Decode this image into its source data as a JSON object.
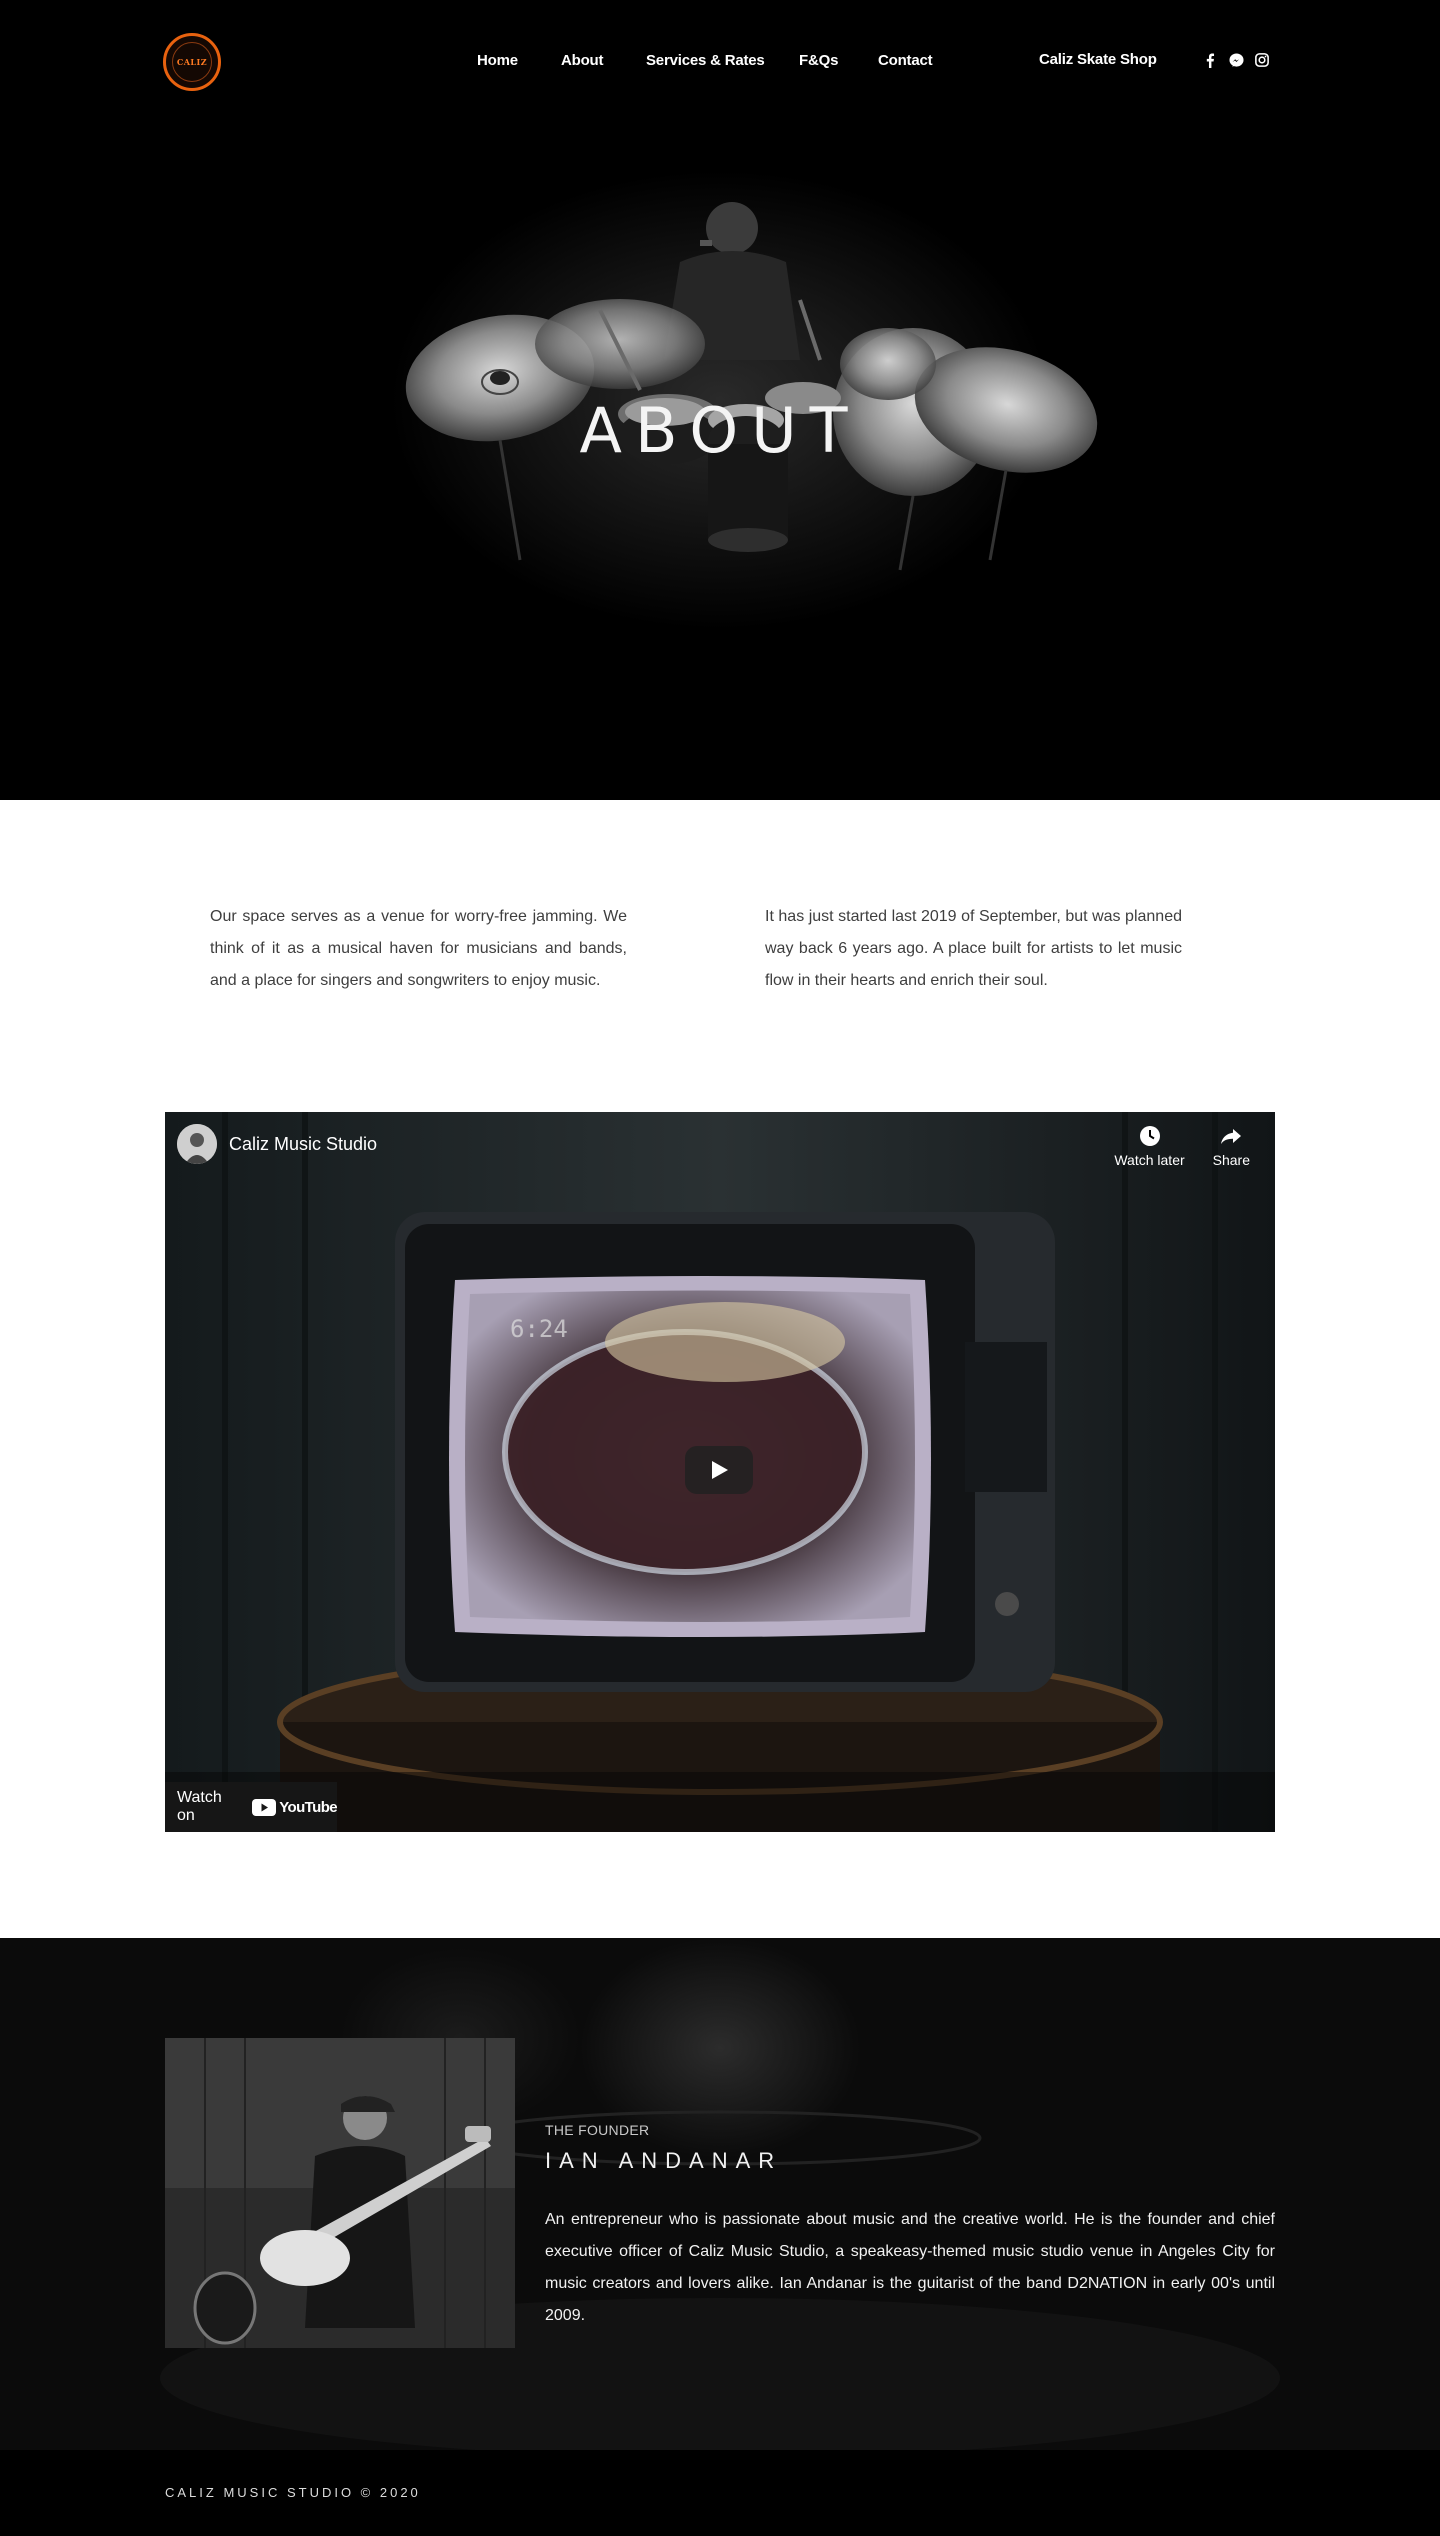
{
  "header": {
    "logo_text": "CALIZ",
    "nav": [
      {
        "label": "Home"
      },
      {
        "label": "About"
      },
      {
        "label": "Services & Rates"
      },
      {
        "label": "F&Qs"
      },
      {
        "label": "Contact"
      }
    ],
    "shop_label": "Caliz Skate Shop",
    "social_icons": [
      "facebook-icon",
      "messenger-icon",
      "instagram-icon"
    ]
  },
  "hero": {
    "title": "ABOUT"
  },
  "intro": {
    "left": "Our space serves as a venue for worry-free jamming. We think of it as a musical haven for musicians and bands, and a place for singers and songwriters to enjoy music.",
    "right": "It has just started last 2019 of September, but was planned way back 6 years ago. A place built for artists to let music flow in their hearts and enrich their soul."
  },
  "video": {
    "channel_name": "Caliz Music Studio",
    "watch_later": "Watch later",
    "share": "Share",
    "watch_on": "Watch on",
    "youtube_word": "YouTube"
  },
  "founder": {
    "kicker": "THE FOUNDER",
    "name": "IAN ANDANAR",
    "bio": "An entrepreneur who is passionate about music and the creative world. He is the founder and chief executive officer of Caliz Music Studio, a speakeasy-themed music studio venue in Angeles City for music creators and lovers alike. Ian Andanar is the guitarist of the band D2NATION in early 00's until 2009."
  },
  "footer": {
    "copyright": "CALIZ MUSIC STUDIO © 2020"
  },
  "colors": {
    "accent": "#e8620f",
    "dark": "#000000",
    "text_body": "#3e3e3e"
  }
}
